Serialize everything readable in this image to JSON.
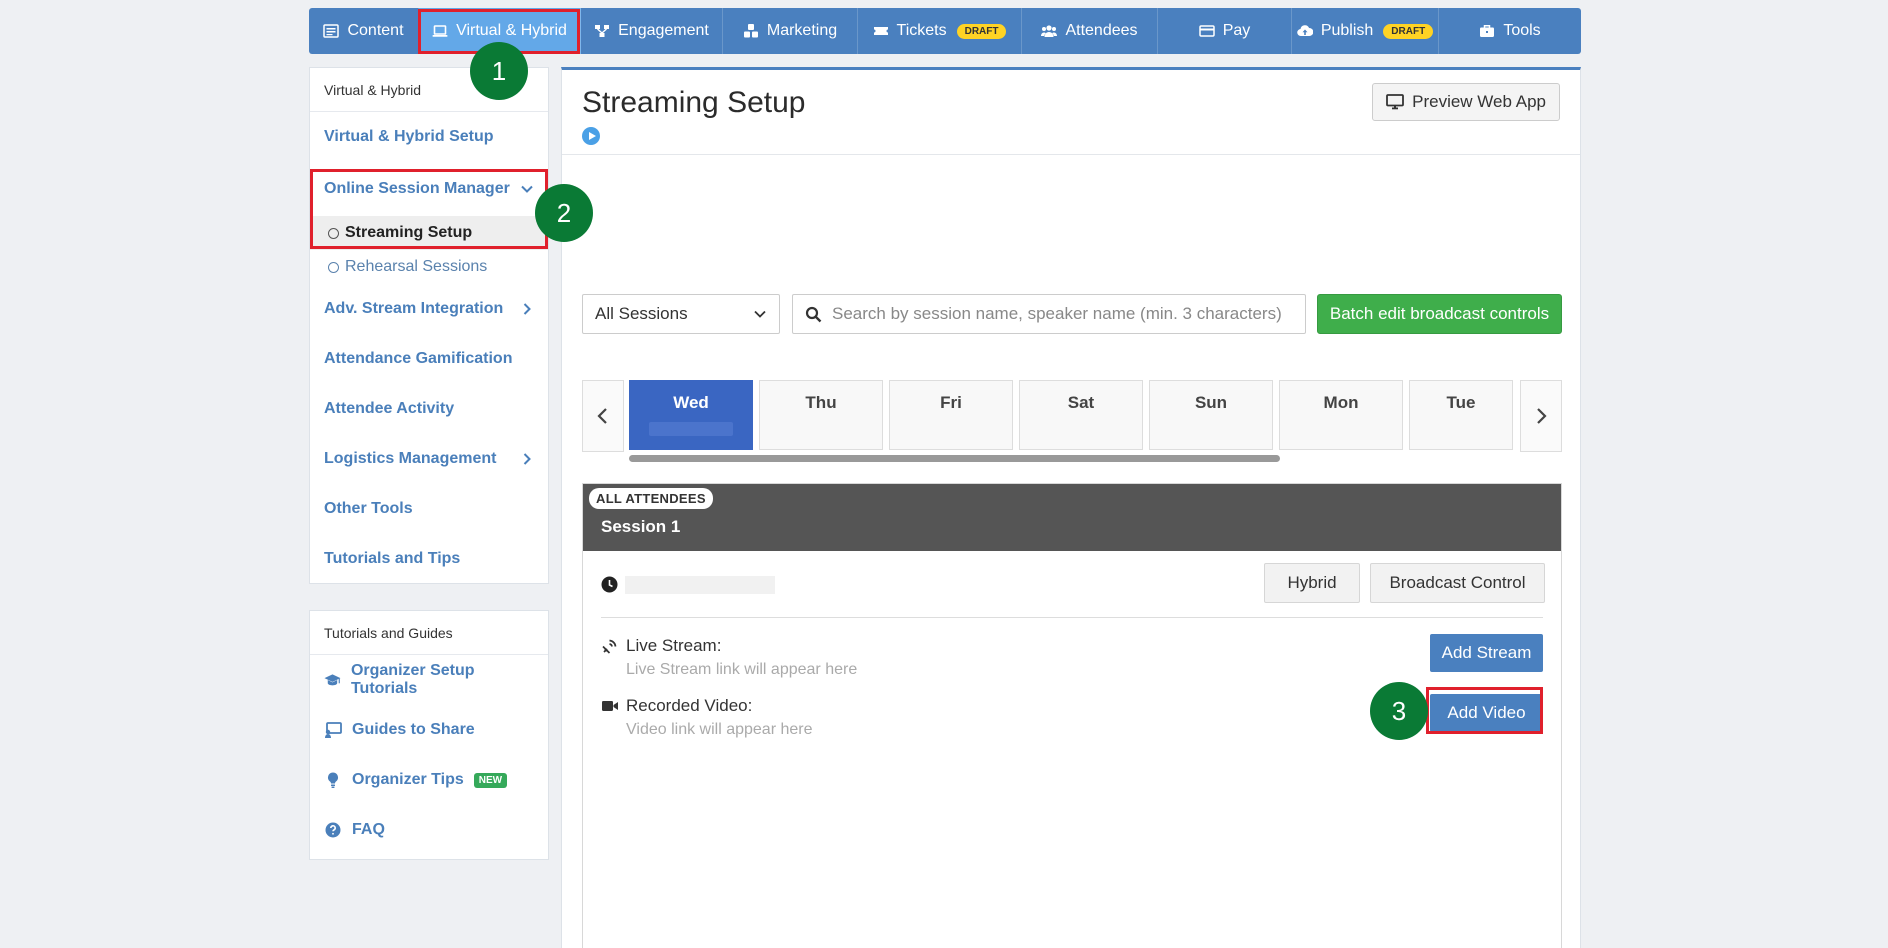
{
  "topnav": {
    "tabs": [
      {
        "label": "Content",
        "icon": "list-icon"
      },
      {
        "label": "Virtual & Hybrid",
        "icon": "laptop-icon",
        "active": true
      },
      {
        "label": "Engagement",
        "icon": "network-icon"
      },
      {
        "label": "Marketing",
        "icon": "cubes-icon"
      },
      {
        "label": "Tickets",
        "icon": "ticket-icon",
        "badge": "DRAFT"
      },
      {
        "label": "Attendees",
        "icon": "users-icon"
      },
      {
        "label": "Pay",
        "icon": "card-icon"
      },
      {
        "label": "Publish",
        "icon": "cloud-upload-icon",
        "badge": "DRAFT"
      },
      {
        "label": "Tools",
        "icon": "briefcase-icon"
      }
    ]
  },
  "sidebar": {
    "header": "Virtual & Hybrid",
    "items": [
      {
        "label": "Virtual & Hybrid Setup"
      },
      {
        "label": "Online Session Manager",
        "expanded": true,
        "children": [
          "Streaming Setup",
          "Rehearsal Sessions"
        ],
        "active_child": "Streaming Setup"
      },
      {
        "label": "Adv. Stream Integration",
        "has_submenu": true
      },
      {
        "label": "Attendance Gamification"
      },
      {
        "label": "Attendee Activity"
      },
      {
        "label": "Logistics Management",
        "has_submenu": true
      },
      {
        "label": "Other Tools"
      },
      {
        "label": "Tutorials and Tips"
      }
    ]
  },
  "guides": {
    "header": "Tutorials and Guides",
    "items": [
      {
        "label": "Organizer Setup Tutorials",
        "icon": "graduation-cap-icon"
      },
      {
        "label": "Guides to Share",
        "icon": "presentation-icon"
      },
      {
        "label": "Organizer Tips",
        "icon": "lightbulb-icon",
        "badge": "NEW"
      },
      {
        "label": "FAQ",
        "icon": "question-circle-icon"
      }
    ]
  },
  "main": {
    "title": "Streaming Setup",
    "preview_label": "Preview Web App",
    "filter": {
      "selected": "All Sessions"
    },
    "search": {
      "placeholder": "Search by session name, speaker name (min. 3 characters)"
    },
    "batch_label": "Batch edit broadcast controls",
    "days": [
      "Wed",
      "Thu",
      "Fri",
      "Sat",
      "Sun",
      "Mon",
      "Tue"
    ],
    "active_day": "Wed",
    "session": {
      "audience": "ALL ATTENDEES",
      "title": "Session 1",
      "hybrid_label": "Hybrid",
      "broadcast_label": "Broadcast Control",
      "live_label": "Live Stream:",
      "live_hint": "Live Stream link will appear here",
      "add_stream_label": "Add Stream",
      "recorded_label": "Recorded Video:",
      "recorded_hint": "Video link will appear here",
      "add_video_label": "Add Video"
    }
  },
  "annotations": [
    "1",
    "2",
    "3"
  ],
  "colors": {
    "nav": "#4a80bf",
    "nav_active": "#63a8e8",
    "green": "#3fae4b",
    "highlight": "#e0202c",
    "marker": "#0a7a35",
    "day_active": "#3a66c2"
  }
}
